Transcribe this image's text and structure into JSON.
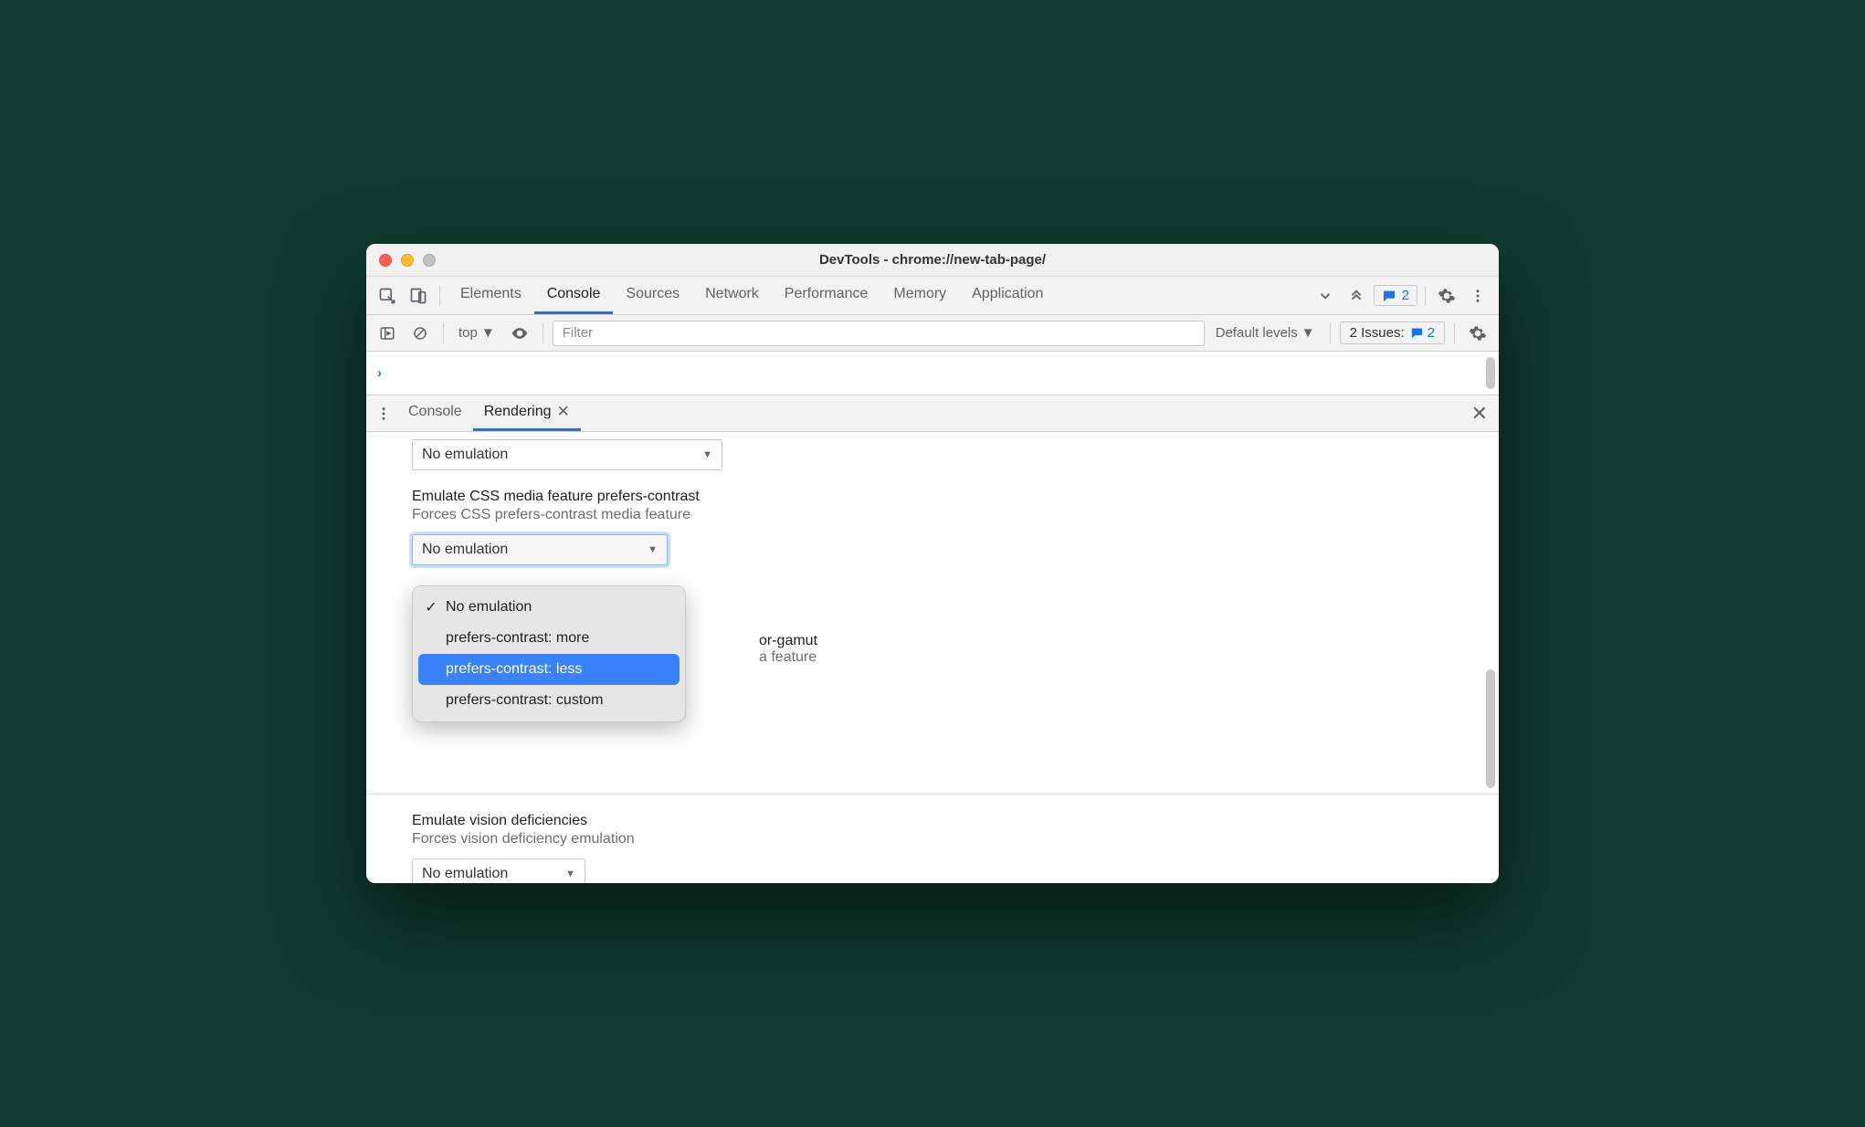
{
  "window": {
    "title": "DevTools - chrome://new-tab-page/"
  },
  "mainTabs": {
    "items": [
      "Elements",
      "Console",
      "Sources",
      "Network",
      "Performance",
      "Memory",
      "Application"
    ],
    "activeIndex": 1,
    "messagesBadge": "2"
  },
  "consoleToolbar": {
    "context": "top",
    "filterPlaceholder": "Filter",
    "levels": "Default levels",
    "issuesLabel": "2 Issues:",
    "issuesCount": "2"
  },
  "consoleBody": {
    "promptGlyph": "›"
  },
  "drawer": {
    "tabs": [
      {
        "label": "Console",
        "active": false
      },
      {
        "label": "Rendering",
        "active": true
      }
    ]
  },
  "rendering": {
    "topSelect": "No emulation",
    "contrast": {
      "title": "Emulate CSS media feature prefers-contrast",
      "desc": "Forces CSS prefers-contrast media feature",
      "value": "No emulation",
      "options": [
        {
          "label": "No emulation",
          "checked": true,
          "highlight": false
        },
        {
          "label": "prefers-contrast: more",
          "checked": false,
          "highlight": false
        },
        {
          "label": "prefers-contrast: less",
          "checked": false,
          "highlight": true
        },
        {
          "label": "prefers-contrast: custom",
          "checked": false,
          "highlight": false
        }
      ]
    },
    "gamut": {
      "titleTail": "or-gamut",
      "descTail": "a feature"
    },
    "vision": {
      "title": "Emulate vision deficiencies",
      "desc": "Forces vision deficiency emulation",
      "value": "No emulation"
    }
  }
}
